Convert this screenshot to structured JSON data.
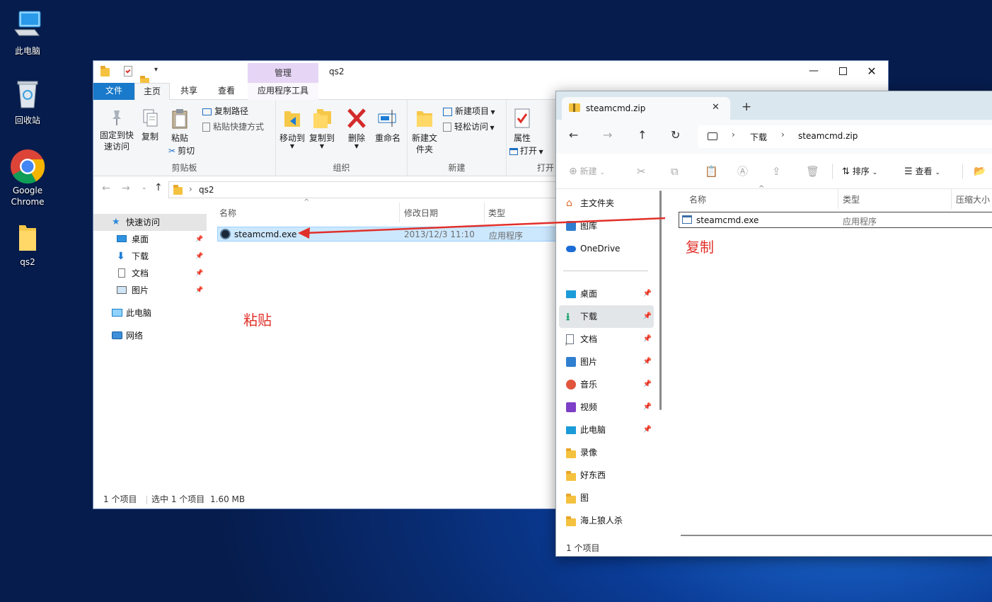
{
  "desktop": {
    "icons": [
      {
        "label": "此电脑"
      },
      {
        "label": "回收站"
      },
      {
        "label": "Google Chrome"
      },
      {
        "label": "qs2"
      }
    ]
  },
  "win10": {
    "title": "qs2",
    "context_tab": "管理",
    "tabs": [
      "文件",
      "主页",
      "共享",
      "查看",
      "应用程序工具"
    ],
    "ribbon": {
      "clipboard": {
        "pin": "固定到快速访问",
        "copy": "复制",
        "paste": "粘贴",
        "copy_path": "复制路径",
        "paste_shortcut": "粘贴快捷方式",
        "cut": "剪切",
        "label": "剪贴板"
      },
      "organize": {
        "move_to": "移动到",
        "copy_to": "复制到",
        "delete": "删除",
        "rename": "重命名",
        "label": "组织"
      },
      "new": {
        "new_folder": "新建文件夹",
        "new_item": "新建项目",
        "easy_access": "轻松访问",
        "label": "新建"
      },
      "open": {
        "properties": "属性",
        "open": "打开",
        "label": "打开"
      }
    },
    "address": {
      "path": "qs2"
    },
    "nav": {
      "quick_access": "快速访问",
      "items": [
        "桌面",
        "下载",
        "文档",
        "图片"
      ],
      "this_pc": "此电脑",
      "network": "网络"
    },
    "columns": [
      "名称",
      "修改日期",
      "类型"
    ],
    "files": [
      {
        "name": "steamcmd.exe",
        "date": "2013/12/3 11:10",
        "type": "应用程序"
      }
    ],
    "annotation": "粘贴",
    "status": {
      "count": "1 个项目",
      "selected": "选中 1 个项目",
      "size": "1.60 MB"
    }
  },
  "win11": {
    "tab_title": "steamcmd.zip",
    "breadcrumb": [
      "下载",
      "steamcmd.zip"
    ],
    "toolbar": {
      "new": "新建",
      "sort": "排序",
      "view": "查看"
    },
    "sidebar": {
      "top": [
        {
          "label": "主文件夹",
          "icon": "home-icon"
        },
        {
          "label": "图库",
          "icon": "gallery-icon"
        },
        {
          "label": "OneDrive",
          "icon": "cloud-icon"
        }
      ],
      "pinned": [
        {
          "label": "桌面",
          "icon": "desktop-icon"
        },
        {
          "label": "下载",
          "icon": "download-icon"
        },
        {
          "label": "文档",
          "icon": "document-icon"
        },
        {
          "label": "图片",
          "icon": "picture-icon"
        },
        {
          "label": "音乐",
          "icon": "music-icon"
        },
        {
          "label": "视频",
          "icon": "video-icon"
        },
        {
          "label": "此电脑",
          "icon": "pc-icon"
        }
      ],
      "folders": [
        {
          "label": "录像"
        },
        {
          "label": "好东西"
        },
        {
          "label": "图"
        },
        {
          "label": "海上狼人杀"
        }
      ]
    },
    "columns": [
      "名称",
      "类型",
      "压缩大小"
    ],
    "files": [
      {
        "name": "steamcmd.exe",
        "type": "应用程序"
      }
    ],
    "annotation": "复制",
    "status": "1 个项目"
  },
  "colors": {
    "accent": "#0078d7",
    "annotation": "#e0302a",
    "selection": "#cce8ff"
  }
}
